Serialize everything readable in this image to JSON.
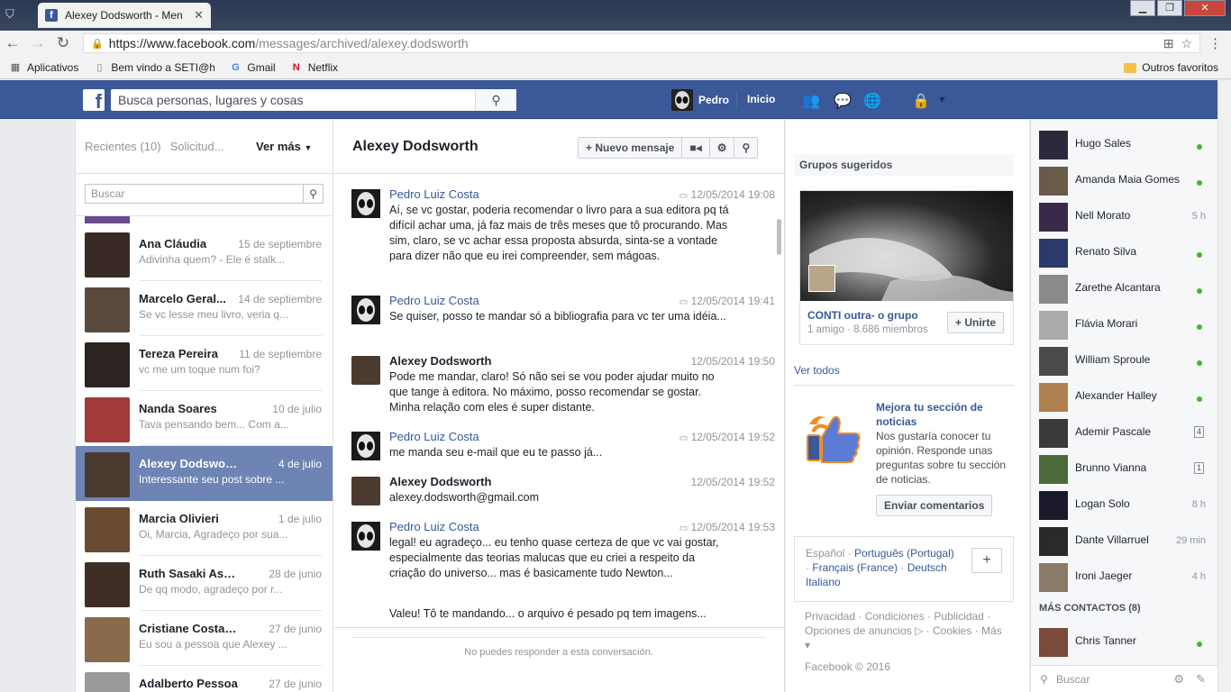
{
  "browser": {
    "tab_title": "Alexey Dodsworth - Men",
    "url_host": "https://www.facebook.com",
    "url_path": "/messages/archived/alexey.dodsworth",
    "bookmarks": [
      "Aplicativos",
      "Bem vindo a SETI@ho",
      "Gmail",
      "Netflix"
    ],
    "other_bookmarks": "Outros favoritos"
  },
  "fb": {
    "search_placeholder": "Busca personas, lugares y cosas",
    "user": "Pedro",
    "home": "Inicio"
  },
  "left": {
    "recent": "Recientes",
    "recent_count": "(10)",
    "requests": "Solicitud...",
    "more": "Ver más",
    "search_placeholder": "Buscar",
    "threads": [
      {
        "name": "Ana Cláudia",
        "date": "15 de septiembre",
        "preview": "Adivinha quem? - Ele é stalk...",
        "color": "#3a2a25"
      },
      {
        "name": "Marcelo Geral...",
        "date": "14 de septiembre",
        "preview": "Se vc lesse meu livro, veria q...",
        "color": "#5a4a3e"
      },
      {
        "name": "Tereza Pereira",
        "date": "11 de septiembre",
        "preview": "vc me um toque num foi?",
        "color": "#2c2420"
      },
      {
        "name": "Nanda Soares",
        "date": "10 de julio",
        "preview": "Tava pensando bem... Com a...",
        "color": "#a23a3a"
      },
      {
        "name": "Alexey Dodsworth",
        "date": "4 de julio",
        "preview": "Interessante seu post sobre ...",
        "color": "#4a3a30"
      },
      {
        "name": "Marcia Olivieri",
        "date": "1 de julio",
        "preview": "Oi, Marcia, Agradeço por sua...",
        "color": "#6b4a32"
      },
      {
        "name": "Ruth Sasaki Astrolo...",
        "date": "28 de junio",
        "preview": "De qq modo, agradeço por r...",
        "color": "#3e2e26"
      },
      {
        "name": "Cristiane Costa Cruz",
        "date": "27 de junio",
        "preview": "Eu sou a pessoa que Alexey ...",
        "color": "#8a6a4a"
      },
      {
        "name": "Adalberto Pessoa",
        "date": "27 de junio",
        "preview": "",
        "color": "#9a9a9a"
      }
    ]
  },
  "conversation": {
    "title": "Alexey Dodsworth",
    "new_message": "Nuevo mensaje",
    "messages": [
      {
        "from": "Pedro Luiz Costa",
        "time": "12/05/2014 19:08",
        "text": "Aí, se vc gostar, poderia recomendar o livro para a sua editora pq tá difícil achar uma, já faz mais de três meses que tô procurando. Mas sim, claro, se vc achar essa proposta absurda, sinta-se a vontade para dizer não que eu irei compreender, sem mágoas."
      },
      {
        "from": "Pedro Luiz Costa",
        "time": "12/05/2014 19:41",
        "text": "Se quiser, posso te mandar só a bibliografia para vc ter uma idéia..."
      },
      {
        "from": "Alexey Dodsworth",
        "time": "12/05/2014 19:50",
        "text": "Pode me mandar, claro! Só não sei se vou poder ajudar muito no que tange à editora. No máximo, posso recomendar se gostar. Minha relação com eles é super distante."
      },
      {
        "from": "Pedro Luiz Costa",
        "time": "12/05/2014 19:52",
        "text": "me manda seu e-mail que eu te passo já..."
      },
      {
        "from": "Alexey Dodsworth",
        "time": "12/05/2014 19:52",
        "text": "alexey.dodsworth@gmail.com"
      },
      {
        "from": "Pedro Luiz Costa",
        "time": "12/05/2014 19:53",
        "text": "legal! eu agradeço... eu tenho quase certeza de que vc vai gostar, especialmente das teorias malucas que eu criei a respeito da criação do universo... mas é basicamente tudo Newton..."
      },
      {
        "from": "",
        "time": "",
        "text": "Valeu! Tô te mandando... o arquivo é pesado pq tem imagens..."
      }
    ],
    "footer": "No puedes responder a esta conversación."
  },
  "right": {
    "groups_title": "Grupos sugeridos",
    "group_name": "CONTI outra- o grupo",
    "group_meta": "1 amigo · 8.686 miembros",
    "join": "+ Unirte",
    "see_all": "Ver todos",
    "improve_title": "Mejora tu sección de noticias",
    "improve_text": "Nos gustaría conocer tu opinión. Responde unas preguntas sobre tu sección de noticias.",
    "feedback": "Enviar comentarios",
    "lang_current": "Español",
    "langs": [
      "Português (Portugal)",
      "Français (France)",
      "Deutsch",
      "Italiano"
    ],
    "footer_links": "Privacidad · Condiciones · Publicidad · Opciones de anuncios ▷ · Cookies · Más ▾",
    "copyright": "Facebook © 2016"
  },
  "chat": {
    "contacts": [
      {
        "name": "Hugo Sales",
        "status": "online",
        "color": "#2a2a3a"
      },
      {
        "name": "Amanda Maia Gomes",
        "status": "online",
        "color": "#6a5a4a"
      },
      {
        "name": "Nell Morato",
        "status": "5 h",
        "color": "#3a2a4a"
      },
      {
        "name": "Renato Silva",
        "status": "online",
        "color": "#2a3a6a"
      },
      {
        "name": "Zarethe Alcantara",
        "status": "online",
        "color": "#8a8a8a"
      },
      {
        "name": "Flávia Morari",
        "status": "online",
        "color": "#aaaaaa"
      },
      {
        "name": "William Sproule",
        "status": "online",
        "color": "#4a4a4a"
      },
      {
        "name": "Alexander Halley",
        "status": "online",
        "color": "#b08050"
      },
      {
        "name": "Ademir Pascale",
        "status": "4",
        "color": "#3a3a3a"
      },
      {
        "name": "Brunno Vianna",
        "status": "1",
        "color": "#4a6a3a"
      },
      {
        "name": "Logan Solo",
        "status": "8 h",
        "color": "#1a1a2a"
      },
      {
        "name": "Dante Villarruel",
        "status": "29 min",
        "color": "#2a2a2a"
      },
      {
        "name": "Ironi Jaeger",
        "status": "4 h",
        "color": "#8a7a6a"
      }
    ],
    "more_contacts": "MÁS CONTACTOS (8)",
    "extra_contact": {
      "name": "Chris Tanner",
      "status": "online",
      "color": "#7a4a3a"
    },
    "search_placeholder": "Buscar"
  }
}
